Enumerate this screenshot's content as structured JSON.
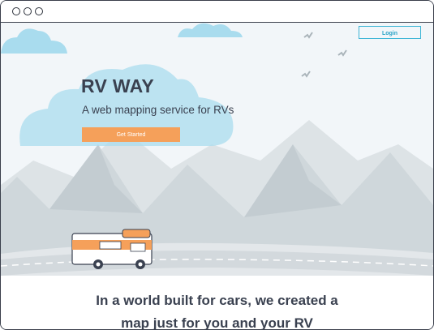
{
  "window": {
    "controls": [
      "close",
      "minimize",
      "maximize"
    ]
  },
  "header": {
    "login_label": "Login"
  },
  "hero": {
    "title": "RV WAY",
    "subtitle": "A web mapping service for RVs",
    "cta_label": "Get Started"
  },
  "tagline": {
    "line1": "In a world built for cars, we created a",
    "line2": "map just for you and your RV"
  },
  "colors": {
    "sky": "#f2f6f9",
    "cloud": "#a9dcee",
    "mountain_back": "#dde3e6",
    "mountain_front": "#cbd3d7",
    "road": "#e3e7ea",
    "accent": "#f5a05a",
    "login_border": "#3fb6d6",
    "text": "#3a4150"
  },
  "icons": [
    "bird-icon",
    "rv-icon",
    "cloud-icon"
  ]
}
